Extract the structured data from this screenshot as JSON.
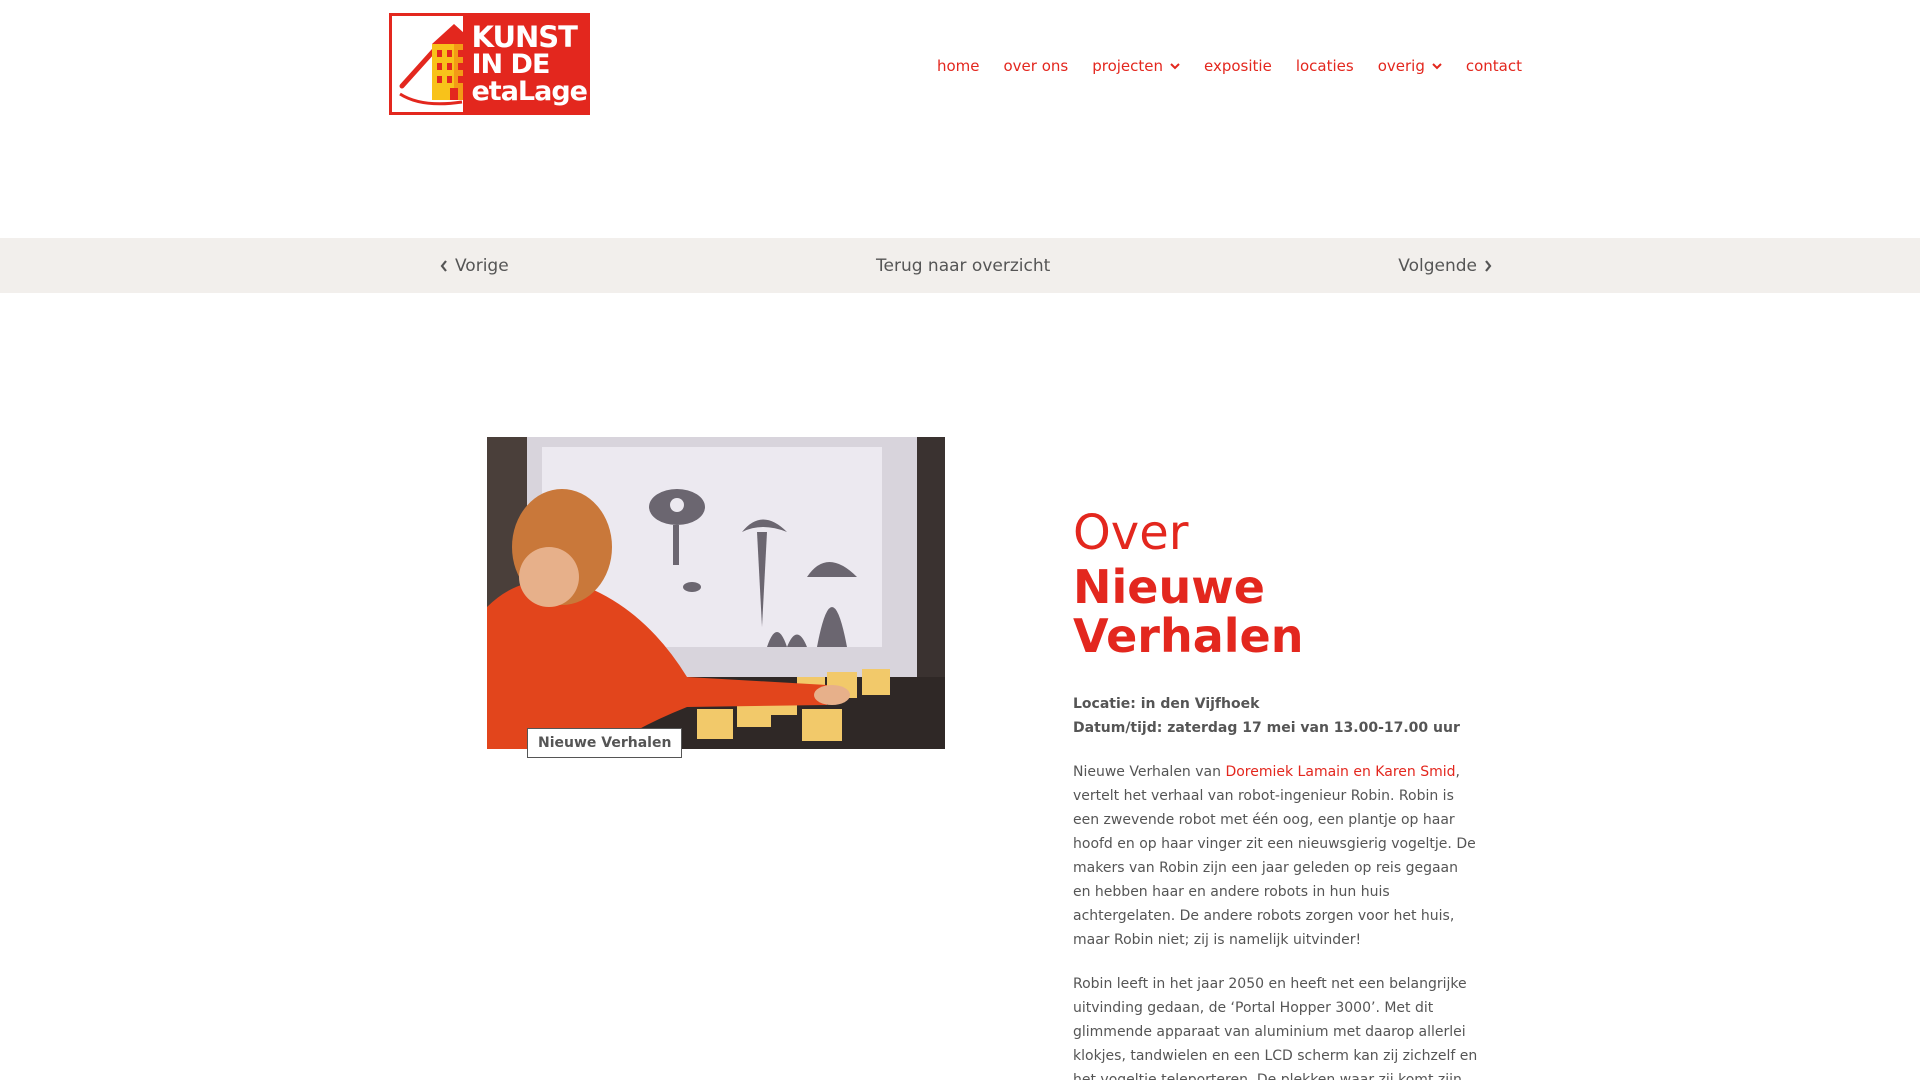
{
  "header": {
    "logo": {
      "line1": "KUNST",
      "line2": "IN DE",
      "line3": "etaLage"
    },
    "nav": [
      {
        "label": "home",
        "dropdown": false
      },
      {
        "label": "over ons",
        "dropdown": false
      },
      {
        "label": "projecten",
        "dropdown": true
      },
      {
        "label": "expositie",
        "dropdown": false
      },
      {
        "label": "locaties",
        "dropdown": false
      },
      {
        "label": "overig",
        "dropdown": true
      },
      {
        "label": "contact",
        "dropdown": false
      }
    ]
  },
  "pager": {
    "prev_label": "Vorige",
    "overview_label": "Terug naar overzicht",
    "next_label": "Volgende"
  },
  "media": {
    "caption": "Nieuwe Verhalen"
  },
  "article": {
    "title_over": "Over",
    "title_line1": "Nieuwe",
    "title_line2": "Verhalen",
    "locatie": "Locatie: in den Vijfhoek",
    "datum": "Datum/tijd: zaterdag 17 mei van 13.00-17.00 uur",
    "p1_prefix": "Nieuwe Verhalen van ",
    "p1_link": "Doremiek Lamain en Karen Smid",
    "p1_rest": ", vertelt het verhaal van robot-ingenieur Robin. Robin is een zwevende robot met één oog, een plantje op haar hoofd en op haar vinger zit een nieuwsgierig vogeltje. De makers van Robin zijn een jaar geleden op reis gegaan en hebben haar en andere robots in hun huis achtergelaten. De andere robots zorgen voor het huis, maar Robin niet; zij is namelijk uitvinder!",
    "p2": "Robin leeft in het jaar 2050 en heeft net een belangrijke uitvinding gedaan, de ‘Portal Hopper 3000’. Met dit glimmende apparaat van aluminium met daarop allerlei klokjes, tandwielen en een LCD scherm kan zij zichzelf en het vogeltje teleporteren. De plekken waar zij komt zijn"
  },
  "colors": {
    "accent": "#e3271e",
    "text": "#555555",
    "pager_bg": "#f2efec"
  }
}
